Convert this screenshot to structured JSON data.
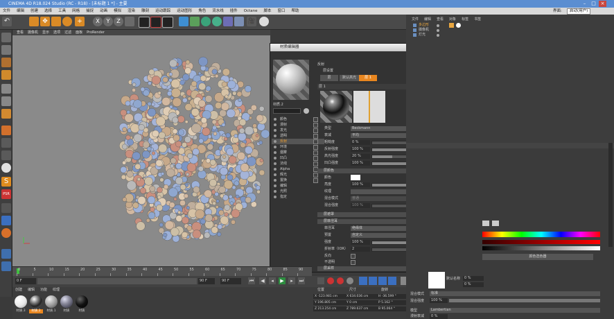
{
  "window": {
    "title": "CINEMA 4D R18.024 Studio (RC - R18) - [未标题 1 *] - 主要"
  },
  "menubar": [
    "文件",
    "编辑",
    "创建",
    "选择",
    "工具",
    "网格",
    "捕捉",
    "动画",
    "模拟",
    "渲染",
    "雕刻",
    "运动跟踪",
    "运动图形",
    "角色",
    "流水线",
    "插件",
    "Octane",
    "脚本",
    "窗口",
    "帮助"
  ],
  "menubar_right": {
    "layout_label": "界面:",
    "layout_value": "启动(用户)"
  },
  "viewport": {
    "menu": [
      "查看",
      "摄像机",
      "显示",
      "选项",
      "过滤",
      "面板",
      "ProRender"
    ]
  },
  "object_manager": {
    "menu": [
      "文件",
      "编辑",
      "查看",
      "对象",
      "标签",
      "书签"
    ],
    "objects": [
      {
        "name": "多边形",
        "color": "#e8a640"
      },
      {
        "name": "摄像机",
        "color": "#cccccc"
      },
      {
        "name": "灯光",
        "color": "#cccccc"
      }
    ]
  },
  "material_editor": {
    "title": "材质编辑器",
    "material_name": "材质.2",
    "header_label": "反射",
    "layer_tabs": {
      "label": "层设置",
      "tabs": [
        "层",
        "默认高光",
        "层 1"
      ],
      "active": 2
    },
    "layer_title": "层 1",
    "channels": [
      "颜色",
      "漫射",
      "发光",
      "透明",
      "反射",
      "环境",
      "烟雾",
      "凹凸",
      "法线",
      "Alpha",
      "辉光",
      "置换",
      "编辑",
      "光照",
      "指定"
    ],
    "props": [
      {
        "label": "类型",
        "value": "Beckmann"
      },
      {
        "label": "衰减",
        "value": "平均"
      },
      {
        "label": "粗糙度",
        "value": "0 %",
        "fill": 0
      },
      {
        "label": "反射强度",
        "value": "100 %",
        "fill": 1
      },
      {
        "label": "高光强度",
        "value": "20 %",
        "fill": 0.2
      },
      {
        "label": "凹凸强度",
        "value": "100 %",
        "fill": 1
      }
    ],
    "color_section": {
      "title": "层颜色",
      "color_label": "颜色",
      "brightness_label": "亮度",
      "brightness_value": "100 %",
      "texture_label": "纹理",
      "mix_mode_label": "混合模式",
      "mix_mode_value": "普通",
      "mix_strength_label": "混合强度",
      "mix_strength_value": "100 %"
    },
    "mask_section": "层遮罩",
    "fresnel_section": {
      "title": "层菲涅耳",
      "fresnel_label": "菲涅耳",
      "fresnel_value": "绝缘体",
      "preset_label": "预置",
      "preset_value": "自定义",
      "strength_label": "强度",
      "strength_value": "100 %",
      "ior_label": "折射率（IOR）",
      "ior_value": "2",
      "invert_label": "反向",
      "opaque_label": "不透明"
    },
    "sampling_section": "层采样"
  },
  "timeline": {
    "ticks": [
      "0",
      "5",
      "10",
      "15",
      "20",
      "25",
      "30",
      "35",
      "40",
      "45",
      "50",
      "55",
      "60",
      "65",
      "70",
      "75",
      "80",
      "85",
      "90"
    ],
    "end_label": "0 F"
  },
  "transport": {
    "start": "0 F",
    "current": "0 F",
    "end": "90 F",
    "end2": "90 F"
  },
  "material_panel": {
    "menu": [
      "创建",
      "编辑",
      "功能",
      "纹理"
    ],
    "materials": [
      {
        "name": "材质.3",
        "kind": "white"
      },
      {
        "name": "材质.2",
        "kind": "chrome",
        "selected": true
      },
      {
        "name": "材质.1",
        "kind": "grey"
      },
      {
        "name": "材质",
        "kind": "env"
      },
      {
        "name": "材质",
        "kind": "black"
      }
    ]
  },
  "coords": {
    "headers": [
      "位置",
      "尺寸",
      "旋转"
    ],
    "rows": [
      {
        "p": "X -123.981 cm",
        "s": "X 634.036 cm",
        "r": "H -36.599 °"
      },
      {
        "p": "Y 196.805 cm",
        "s": "Y 0 cm",
        "r": "P 5.162 °"
      },
      {
        "p": "Z 213.254 cm",
        "s": "Z 789.637 cm",
        "r": "B 95.064 °"
      }
    ]
  },
  "attributes": {
    "texture_label": "默认名称",
    "color_btn": "颜色选色器",
    "blend_mode_label": "混合模式",
    "blend_mode_value": "标准",
    "blend_strength_label": "混合强度",
    "blend_strength_value": "100 %",
    "model_label": "模型",
    "model_value": "Lambertian",
    "diffuse_label": "漫射衰减",
    "diffuse_value": "0 %",
    "brightness_label": "亮度强度",
    "brightness_value": "0 %",
    "brightness2_value": "0 %"
  }
}
